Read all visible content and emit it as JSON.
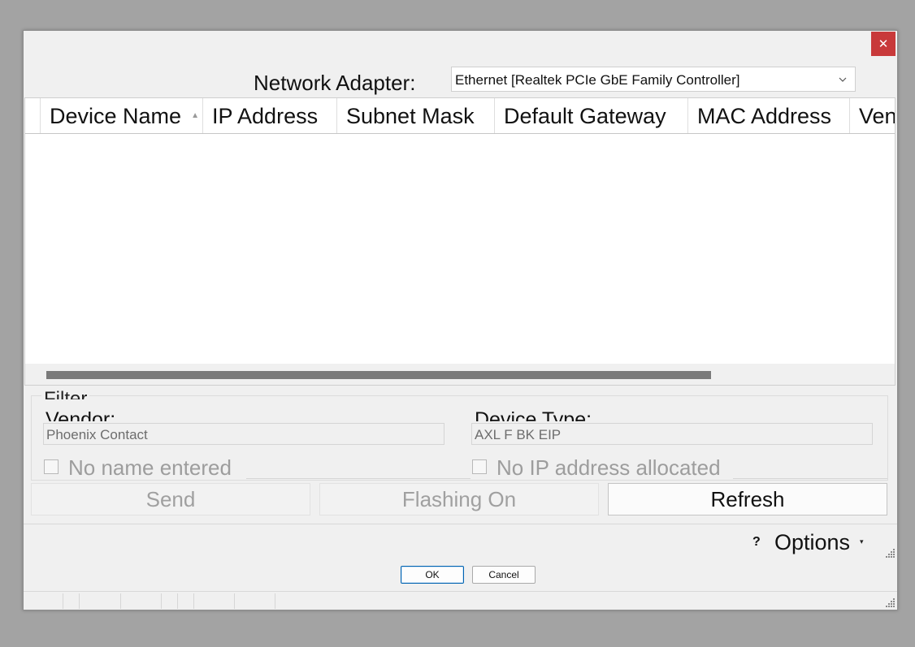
{
  "window": {
    "close_symbol": "✕"
  },
  "adapter": {
    "label": "Network Adapter:",
    "selected": "Ethernet [Realtek PCIe GbE Family Controller]"
  },
  "grid": {
    "columns": [
      "Device Name",
      "IP Address",
      "Subnet Mask",
      "Default Gateway",
      "MAC Address",
      "Ven"
    ],
    "sort_column": "Device Name",
    "rows": []
  },
  "filter": {
    "title": "Filter",
    "vendor_label": "Vendor:",
    "vendor_value": "Phoenix Contact",
    "device_type_label": "Device Type:",
    "device_type_value": "AXL F BK EIP",
    "no_name_label": "No name entered",
    "no_name_checked": false,
    "no_ip_label": "No IP address allocated",
    "no_ip_checked": false
  },
  "actions": {
    "send": "Send",
    "flashing": "Flashing On",
    "refresh": "Refresh"
  },
  "options": {
    "help_symbol": "?",
    "label": "Options"
  },
  "dialog_buttons": {
    "ok": "OK",
    "cancel": "Cancel"
  },
  "colors": {
    "close_bg": "#c8393a",
    "ok_border": "#0063b1",
    "backdrop": "#a3a3a3"
  }
}
